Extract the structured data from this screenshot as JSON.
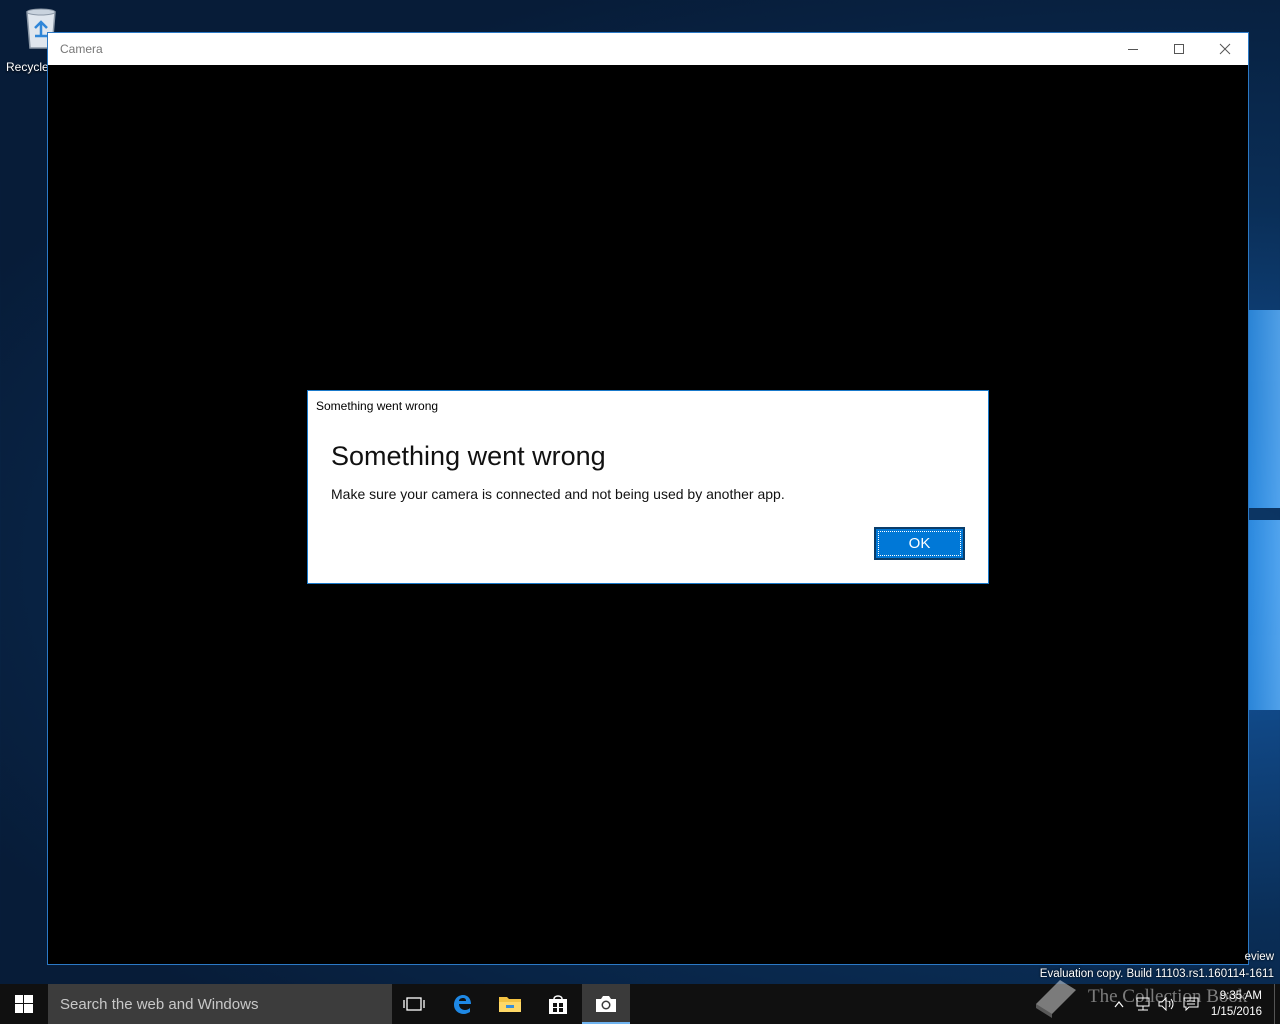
{
  "desktop": {
    "recycle_bin_label": "Recycle"
  },
  "window": {
    "title": "Camera"
  },
  "dialog": {
    "title": "Something went wrong",
    "heading": "Something went wrong",
    "message": "Make sure your camera is connected and not being used by another app.",
    "ok_label": "OK"
  },
  "watermark": {
    "line1": "eview",
    "line2": "Evaluation copy. Build 11103.rs1.160114-1611"
  },
  "taskbar": {
    "search_placeholder": "Search the web and Windows",
    "apps": [
      "task-view",
      "edge",
      "file-explorer",
      "store",
      "camera"
    ],
    "active_app": "camera"
  },
  "tray": {
    "time": "9:35 AM",
    "date": "1/15/2016"
  },
  "brand_overlay": "The Collection Book",
  "colors": {
    "accent": "#0078d7",
    "window_border": "#2b79c6",
    "taskbar": "#101010"
  }
}
